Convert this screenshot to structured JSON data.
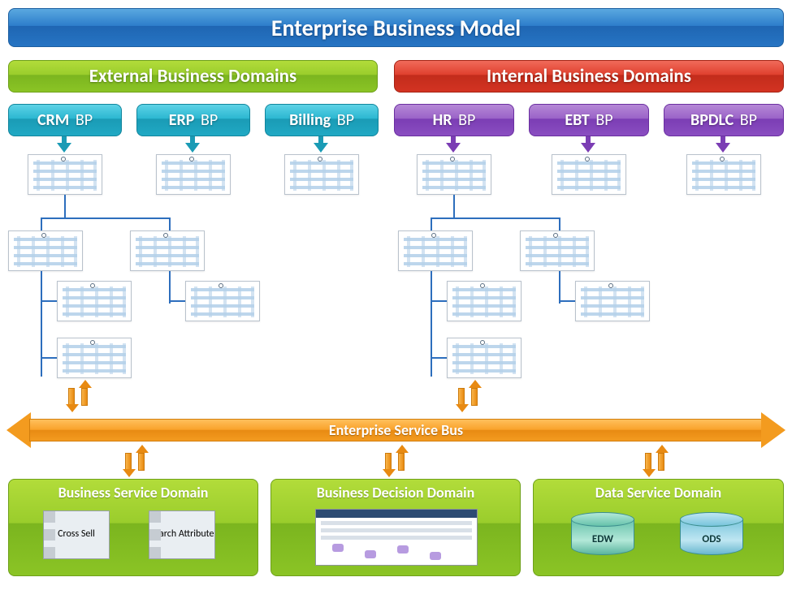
{
  "title": "Enterprise Business Model",
  "external": {
    "heading": "External Business Domains",
    "bps": [
      {
        "name": "CRM",
        "suffix": "BP"
      },
      {
        "name": "ERP",
        "suffix": "BP"
      },
      {
        "name": "Billing",
        "suffix": "BP"
      }
    ]
  },
  "internal": {
    "heading": "Internal Business Domains",
    "bps": [
      {
        "name": "HR",
        "suffix": "BP"
      },
      {
        "name": "EBT",
        "suffix": "BP"
      },
      {
        "name": "BPDLC",
        "suffix": "BP"
      }
    ]
  },
  "bus": "Enterprise Service Bus",
  "bottom": {
    "service": {
      "title": "Business Service Domain",
      "tiles": [
        "Cross Sell",
        "Search Attribute"
      ]
    },
    "decision": {
      "title": "Business Decision Domain"
    },
    "data": {
      "title": "Data Service Domain",
      "cylinders": [
        "EDW",
        "ODS"
      ]
    }
  }
}
